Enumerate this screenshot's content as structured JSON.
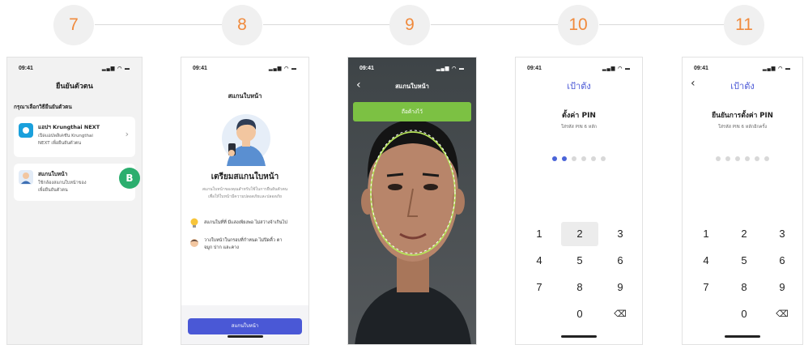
{
  "steps": [
    "7",
    "8",
    "9",
    "10",
    "11"
  ],
  "status_time": "09:41",
  "status_icons": "▂▄▆ ◠ ▬",
  "screen7": {
    "title": "ยืนยันตัวตน",
    "section": "กรุณาเลือกวิธียืนยันตัวตน",
    "option1_title": "แอปฯ Krungthai NEXT",
    "option1_desc_line1": "เปิดแอปพลิเคชัน Krungthai",
    "option1_desc_line2": "NEXT เพื่อยืนยันตัวตน",
    "option2_title": "สแกนใบหน้า",
    "option2_desc_line1": "ใช้กล้องสแกนใบหน้าของ",
    "option2_desc_line2": "เพื่อยืนยันตัวตน",
    "badge": "B",
    "chevron": "›"
  },
  "screen8": {
    "title": "สแกนใบหน้า",
    "heading": "เตรียมสแกนใบหน้า",
    "desc_line1": "สแกนใบหน้าของคุณสำหรับใช้ในการยืนยันตัวตน",
    "desc_line2": "เพื่อให้ใบหน้ามีความปลอดภัยและปลอดภัย",
    "tip1": "สแกนในที่ที่ มีแสงเพียงพอ ไม่สว่างจ้าเกินไป",
    "tip2_line1": "วางใบหน้าในกรอบที่กำหนด ไม่ปิดคิ้ว ตา",
    "tip2_line2": "จมูก ปาก และคาง",
    "button": "สแกนใบหน้า"
  },
  "screen9": {
    "title": "สแกนใบหน้า",
    "banner": "ถือค้างไว้"
  },
  "screen10": {
    "title": "เป้าตัง",
    "heading": "ตั้งค่า PIN",
    "sub": "ใส่รหัส PIN 6 หลัก"
  },
  "screen11": {
    "title": "เป้าตัง",
    "heading": "ยืนยันการตั้งค่า PIN",
    "sub": "ใส่รหัส PIN 6 หลักอีกครั้ง"
  },
  "keypad": [
    "1",
    "2",
    "3",
    "4",
    "5",
    "6",
    "7",
    "8",
    "9",
    "0",
    "⌫"
  ],
  "colors": {
    "accent": "#f08a3c",
    "brand_blue": "#4a58d6",
    "green": "#2bae6e",
    "lime": "#7cc143",
    "pin_active": "#4a64d8",
    "pin_idle": "#d8d8d8"
  }
}
